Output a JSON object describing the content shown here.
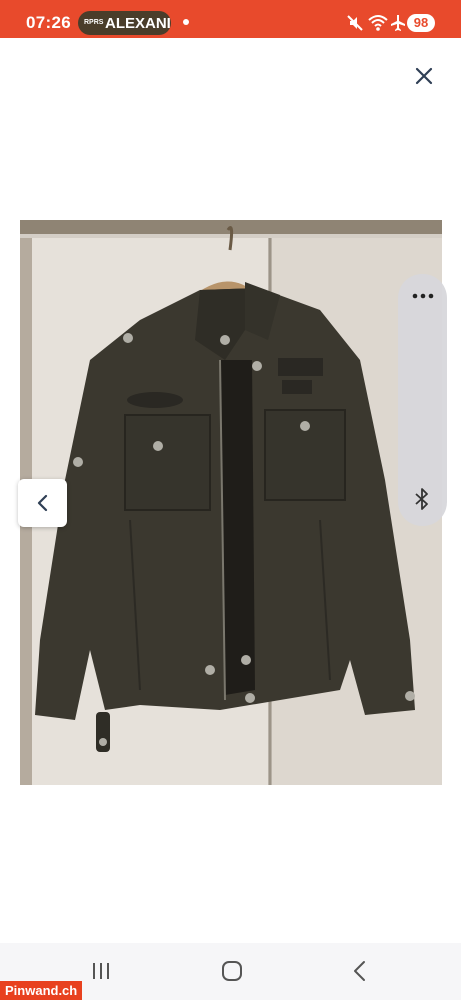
{
  "status_bar": {
    "time": "07:26",
    "notification_tag": "RPRS",
    "notification_text": "ALEXANI",
    "battery": "98",
    "icons": [
      "mute-icon",
      "wifi-icon",
      "airplane-icon"
    ],
    "background_color": "#e84a2c"
  },
  "viewer": {
    "close_icon": "close-icon",
    "prev_icon": "chevron-left-icon",
    "image_description_icon": "jacket-photo"
  },
  "edge_panel": {
    "more_icon": "more-icon",
    "bluetooth_icon": "bluetooth-icon"
  },
  "nav_bar": {
    "recents_icon": "recents-icon",
    "home_icon": "home-icon",
    "back_icon": "back-icon"
  },
  "watermark": {
    "text": "Pinwand.ch",
    "color": "#e8411f"
  }
}
